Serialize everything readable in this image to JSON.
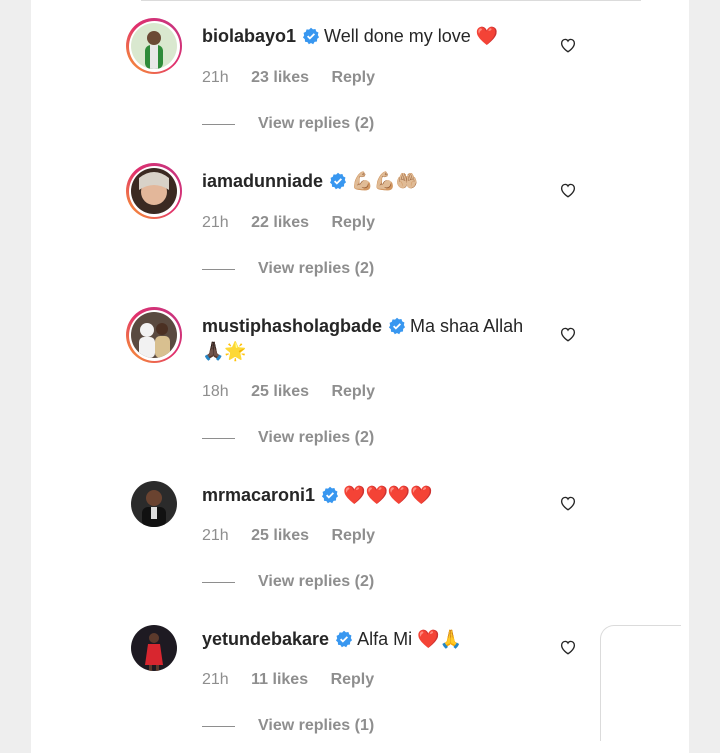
{
  "comments": [
    {
      "username": "biolabayo1",
      "text": "Well done my love ❤️",
      "time": "21h",
      "likes": "23 likes",
      "reply": "Reply",
      "view_replies": "View replies (2)"
    },
    {
      "username": "iamadunniade",
      "text": "💪🏼💪🏼🤲🏼",
      "time": "21h",
      "likes": "22 likes",
      "reply": "Reply",
      "view_replies": "View replies (2)"
    },
    {
      "username": "mustiphasholagbade",
      "text": "Ma shaa Allah 🙏🏿🌟",
      "time": "18h",
      "likes": "25 likes",
      "reply": "Reply",
      "view_replies": "View replies (2)"
    },
    {
      "username": "mrmacaroni1",
      "text": "❤️❤️❤️❤️",
      "time": "21h",
      "likes": "25 likes",
      "reply": "Reply",
      "view_replies": "View replies (2)"
    },
    {
      "username": "yetundebakare",
      "text": "Alfa Mi ❤️🙏",
      "time": "21h",
      "likes": "11 likes",
      "reply": "Reply",
      "view_replies": "View replies (1)"
    }
  ],
  "colors": {
    "verified": "#3897f0",
    "meta": "#8e8e8e",
    "text": "#262626"
  }
}
